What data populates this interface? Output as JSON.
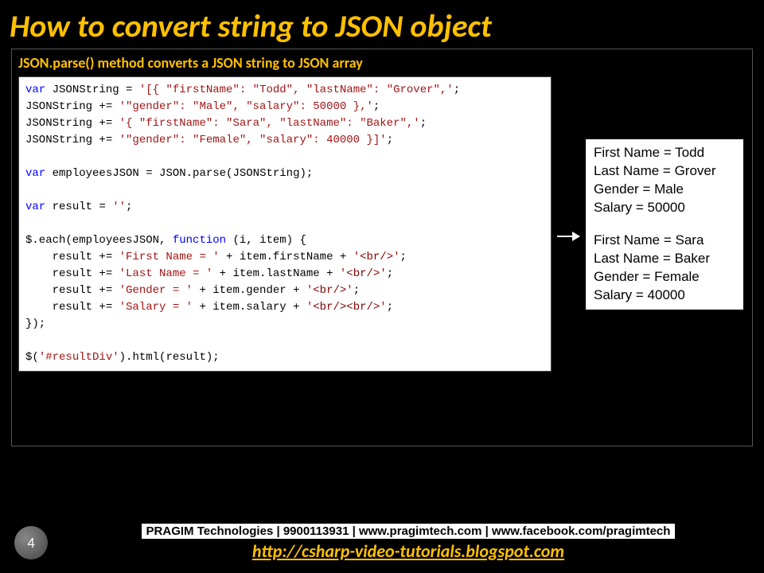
{
  "title": "How to convert string to JSON object",
  "subtitle": "JSON.parse() method converts a JSON string to JSON array",
  "code": {
    "l1a": "var",
    "l1b": " JSONString = ",
    "l1c": "'[{ \"firstName\": \"Todd\", \"lastName\": \"Grover\",'",
    "l1d": ";",
    "l2a": "JSONString += ",
    "l2b": "'\"gender\": \"Male\", \"salary\": 50000 },'",
    "l2c": ";",
    "l3a": "JSONString += ",
    "l3b": "'{ \"firstName\": \"Sara\", \"lastName\": \"Baker\",'",
    "l3c": ";",
    "l4a": "JSONString += ",
    "l4b": "'\"gender\": \"Female\", \"salary\": 40000 }]'",
    "l4c": ";",
    "l5a": "var",
    "l5b": " employeesJSON = JSON.parse(JSONString);",
    "l6a": "var",
    "l6b": " result = ",
    "l6c": "''",
    "l6d": ";",
    "l7a": "$.each(employeesJSON, ",
    "l7b": "function",
    "l7c": " (i, item) {",
    "l8a": "    result += ",
    "l8b": "'First Name = '",
    "l8c": " + item.firstName + ",
    "l8d": "'",
    "l8e": "<br/>",
    "l8f": "'",
    "l8g": ";",
    "l9a": "    result += ",
    "l9b": "'Last Name = '",
    "l9c": " + item.lastName + ",
    "l9d": "'",
    "l9e": "<br/>",
    "l9f": "'",
    "l9g": ";",
    "l10a": "    result += ",
    "l10b": "'Gender = '",
    "l10c": " + item.gender + ",
    "l10d": "'",
    "l10e": "<br/>",
    "l10f": "'",
    "l10g": ";",
    "l11a": "    result += ",
    "l11b": "'Salary = '",
    "l11c": " + item.salary + ",
    "l11d": "'",
    "l11e": "<br/><br/>",
    "l11f": "'",
    "l11g": ";",
    "l12": "});",
    "l13a": "$(",
    "l13b": "'#resultDiv'",
    "l13c": ").html(result);"
  },
  "output": {
    "r1": "First Name = Todd",
    "r2": "Last Name = Grover",
    "r3": "Gender = Male",
    "r4": "Salary = 50000",
    "r5": "First Name = Sara",
    "r6": "Last Name = Baker",
    "r7": "Gender = Female",
    "r8": "Salary = 40000"
  },
  "footer": {
    "page": "4",
    "company": "PRAGIM Technologies | 9900113931 | www.pragimtech.com | www.facebook.com/pragimtech",
    "url": "http://csharp-video-tutorials.blogspot.com"
  }
}
